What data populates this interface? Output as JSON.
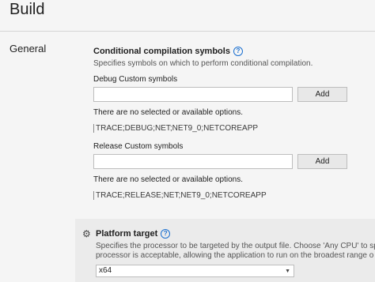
{
  "page": {
    "title": "Build"
  },
  "nav": {
    "section": "General"
  },
  "conditional": {
    "title": "Conditional compilation symbols",
    "help": "?",
    "description": "Specifies symbols on which to perform conditional compilation."
  },
  "debug": {
    "label": "Debug Custom symbols",
    "value": "",
    "add_label": "Add",
    "info": "There are no selected or available options.",
    "symbols": "TRACE;DEBUG;NET;NET9_0;NETCOREAPP"
  },
  "release": {
    "label": "Release Custom symbols",
    "value": "",
    "add_label": "Add",
    "info": "There are no selected or available options.",
    "symbols": "TRACE;RELEASE;NET;NET9_0;NETCOREAPP"
  },
  "platform": {
    "icon": "gear-icon",
    "title": "Platform target",
    "help": "?",
    "description_line1": "Specifies the processor to be targeted by the output file. Choose 'Any CPU' to sp",
    "description_line2": "processor is acceptable, allowing the application to run on the broadest range o",
    "selected": "x64"
  }
}
